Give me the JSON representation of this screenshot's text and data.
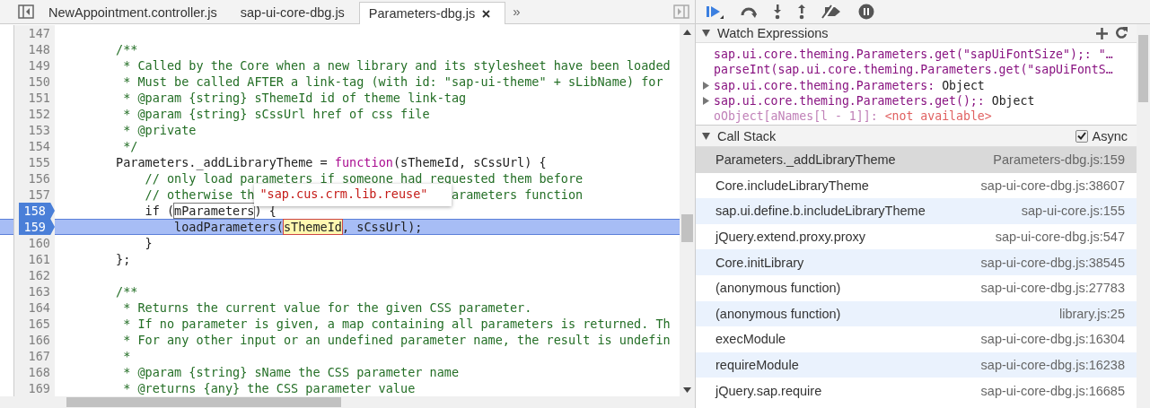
{
  "editor": {
    "tabs": [
      {
        "label": "NewAppointment.controller.js",
        "selected": false,
        "closable": false
      },
      {
        "label": "sap-ui-core-dbg.js",
        "selected": false,
        "closable": false
      },
      {
        "label": "Parameters-dbg.js",
        "selected": true,
        "closable": true
      }
    ],
    "overflow": "»",
    "lines": [
      {
        "number": "147",
        "breakpoint": false,
        "current": false
      },
      {
        "number": "148",
        "breakpoint": false,
        "current": false,
        "segments": [
          {
            "kind": "comment",
            "text": "        /**"
          }
        ]
      },
      {
        "number": "149",
        "breakpoint": false,
        "current": false,
        "segments": [
          {
            "kind": "comment",
            "text": "         * Called by the Core when a new library and its stylesheet have been loaded"
          }
        ]
      },
      {
        "number": "150",
        "breakpoint": false,
        "current": false,
        "segments": [
          {
            "kind": "comment",
            "text": "         * Must be called AFTER a link-tag (with id: \"sap-ui-theme\" + sLibName) for"
          }
        ]
      },
      {
        "number": "151",
        "breakpoint": false,
        "current": false,
        "segments": [
          {
            "kind": "comment",
            "text": "         * @param {string} sThemeId id of theme link-tag"
          }
        ]
      },
      {
        "number": "152",
        "breakpoint": false,
        "current": false,
        "segments": [
          {
            "kind": "comment",
            "text": "         * @param {string} sCssUrl href of css file"
          }
        ]
      },
      {
        "number": "153",
        "breakpoint": false,
        "current": false,
        "segments": [
          {
            "kind": "comment",
            "text": "         * @private"
          }
        ]
      },
      {
        "number": "154",
        "breakpoint": false,
        "current": false,
        "segments": [
          {
            "kind": "comment",
            "text": "         */"
          }
        ]
      },
      {
        "number": "155",
        "breakpoint": false,
        "current": false,
        "segments": [
          {
            "kind": "code",
            "text": "        Parameters._addLibraryTheme = "
          },
          {
            "kind": "keyword",
            "text": "function"
          },
          {
            "kind": "code",
            "text": "(sThemeId, sCssUrl) {"
          }
        ]
      },
      {
        "number": "156",
        "breakpoint": false,
        "current": false,
        "segments": [
          {
            "kind": "comment",
            "text": "            // only load parameters if someone had requested them before"
          }
        ]
      },
      {
        "number": "157",
        "breakpoint": false,
        "current": false,
        "segments": [
          {
            "kind": "comment",
            "text": "            // otherwise th"
          },
          {
            "kind": "popup",
            "text": "\"sap.cus.crm.lib.reuse\""
          },
          {
            "kind": "comment",
            "text": "arameters function"
          }
        ]
      },
      {
        "number": "158",
        "breakpoint": true,
        "current": false,
        "segments": [
          {
            "kind": "code",
            "text": "            if ("
          },
          {
            "kind": "boxed",
            "text": "mParameters"
          },
          {
            "kind": "code",
            "text": ") {"
          }
        ]
      },
      {
        "number": "159",
        "breakpoint": true,
        "current": true,
        "segments": [
          {
            "kind": "code",
            "text": "                loadParameters("
          },
          {
            "kind": "highlight",
            "text": "sThemeId"
          },
          {
            "kind": "code",
            "text": ", sCssUrl);"
          }
        ]
      },
      {
        "number": "160",
        "breakpoint": false,
        "current": false,
        "segments": [
          {
            "kind": "code",
            "text": "            }"
          }
        ]
      },
      {
        "number": "161",
        "breakpoint": false,
        "current": false,
        "segments": [
          {
            "kind": "code",
            "text": "        };"
          }
        ]
      },
      {
        "number": "162",
        "breakpoint": false,
        "current": false
      },
      {
        "number": "163",
        "breakpoint": false,
        "current": false,
        "segments": [
          {
            "kind": "comment",
            "text": "        /**"
          }
        ]
      },
      {
        "number": "164",
        "breakpoint": false,
        "current": false,
        "segments": [
          {
            "kind": "comment",
            "text": "         * Returns the current value for the given CSS parameter."
          }
        ]
      },
      {
        "number": "165",
        "breakpoint": false,
        "current": false,
        "segments": [
          {
            "kind": "comment",
            "text": "         * If no parameter is given, a map containing all parameters is returned. Th"
          }
        ]
      },
      {
        "number": "166",
        "breakpoint": false,
        "current": false,
        "segments": [
          {
            "kind": "comment",
            "text": "         * For any other input or an undefined parameter name, the result is undefin"
          }
        ]
      },
      {
        "number": "167",
        "breakpoint": false,
        "current": false,
        "segments": [
          {
            "kind": "comment",
            "text": "         *"
          }
        ]
      },
      {
        "number": "168",
        "breakpoint": false,
        "current": false,
        "segments": [
          {
            "kind": "comment",
            "text": "         * @param {string} sName the CSS parameter name"
          }
        ]
      },
      {
        "number": "169",
        "breakpoint": false,
        "current": false,
        "segments": [
          {
            "kind": "comment",
            "text": "         * @returns {any} the CSS parameter value"
          }
        ]
      }
    ]
  },
  "watch": {
    "title": "Watch Expressions",
    "expanded": true,
    "items": [
      {
        "name": "sap.ui.core.theming.Parameters.get(\"sapUiFontSize\");:",
        "value": "\"…",
        "kind": "string",
        "expandable": false
      },
      {
        "name": "parseInt(sap.ui.core.theming.Parameters.get(\"sapUiFontS…",
        "kind": "string",
        "expandable": false
      },
      {
        "name": "sap.ui.core.theming.Parameters:",
        "value": "Object",
        "kind": "object",
        "expandable": true
      },
      {
        "name": "sap.ui.core.theming.Parameters.get();:",
        "value": "Object",
        "kind": "object",
        "expandable": true
      },
      {
        "name": "oObject[aNames[l - 1]]:",
        "value": "<not available>",
        "kind": "unavailable",
        "expandable": false
      }
    ]
  },
  "call_stack": {
    "title": "Call Stack",
    "expanded": true,
    "async_label": "Async",
    "async_checked": true,
    "frames": [
      {
        "function": "Parameters._addLibraryTheme",
        "location": "Parameters-dbg.js:159",
        "selected": true
      },
      {
        "function": "Core.includeLibraryTheme",
        "location": "sap-ui-core-dbg.js:38607",
        "selected": false
      },
      {
        "function": "sap.ui.define.b.includeLibraryTheme",
        "location": "sap-ui-core.js:155",
        "selected": false
      },
      {
        "function": "jQuery.extend.proxy.proxy",
        "location": "sap-ui-core-dbg.js:547",
        "selected": false
      },
      {
        "function": "Core.initLibrary",
        "location": "sap-ui-core-dbg.js:38545",
        "selected": false
      },
      {
        "function": "(anonymous function)",
        "location": "sap-ui-core-dbg.js:27783",
        "selected": false
      },
      {
        "function": "(anonymous function)",
        "location": "library.js:25",
        "selected": false
      },
      {
        "function": "execModule",
        "location": "sap-ui-core-dbg.js:16304",
        "selected": false
      },
      {
        "function": "requireModule",
        "location": "sap-ui-core-dbg.js:16238",
        "selected": false
      },
      {
        "function": "jQuery.sap.require",
        "location": "sap-ui-core-dbg.js:16685",
        "selected": false
      }
    ]
  }
}
